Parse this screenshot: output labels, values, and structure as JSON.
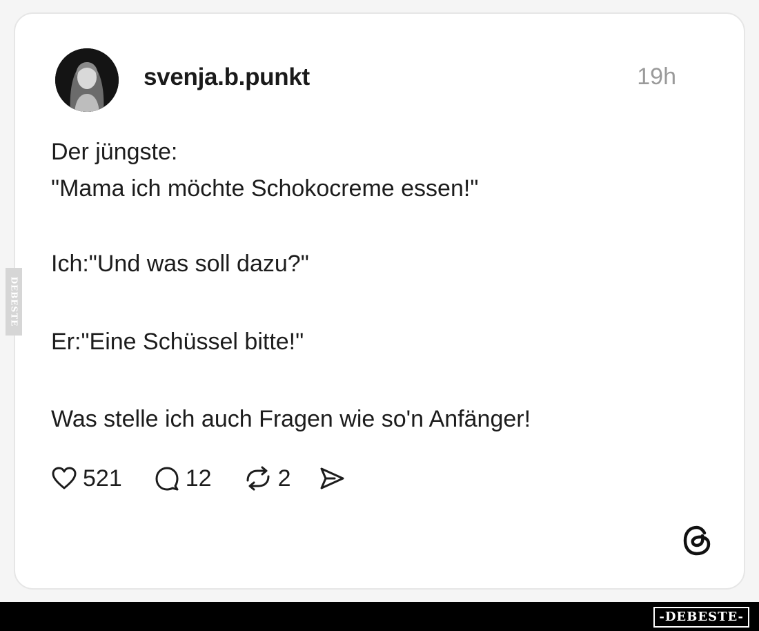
{
  "post": {
    "username": "svenja.b.punkt",
    "time": "19h",
    "lines": [
      "Der jüngste:",
      "\"Mama ich möchte Schokocreme essen!\"",
      "Ich:\"Und was soll dazu?\"",
      "Er:\"Eine Schüssel bitte!\"",
      "Was stelle ich auch Fragen wie so'n Anfänger!"
    ]
  },
  "actions": {
    "likes": "521",
    "comments": "12",
    "reposts": "2"
  },
  "icons": {
    "like": "heart-icon",
    "comment": "comment-bubble-icon",
    "repost": "repost-icon",
    "share": "send-icon",
    "brand": "threads-logo-icon"
  },
  "watermarks": {
    "side": "DEBESTE",
    "bottom": "-DEBESTE-"
  },
  "colors": {
    "text": "#1c1c1c",
    "muted": "#9a9a9a",
    "card": "#ffffff",
    "bar": "#000000"
  }
}
